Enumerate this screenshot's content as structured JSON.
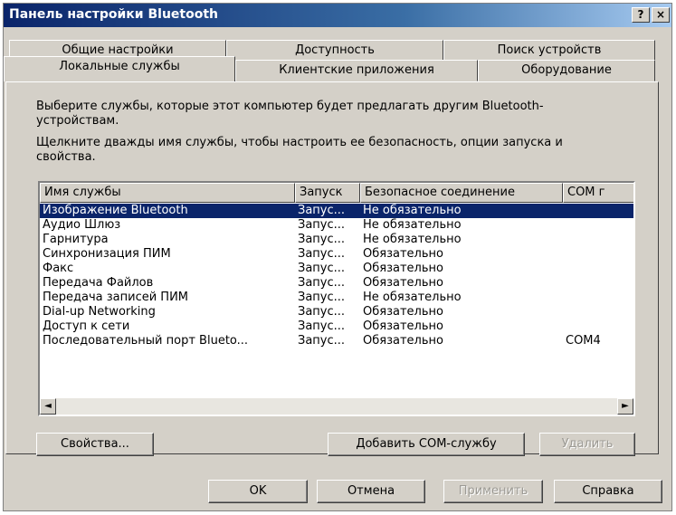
{
  "window": {
    "title": "Панель настройки Bluetooth",
    "help_button": "?",
    "close_button": "×"
  },
  "tabs_row1": [
    "Общие настройки",
    "Доступность",
    "Поиск устройств"
  ],
  "tabs_row2": [
    "Локальные службы",
    "Клиентские приложения",
    "Оборудование"
  ],
  "active_tab": "Локальные службы",
  "description": {
    "line1": "Выберите службы, которые этот компьютер будет предлагать другим Bluetooth-устройствам.",
    "line2": "Щелкните дважды имя службы, чтобы настроить ее безопасность, опции запуска и свойства."
  },
  "list": {
    "columns": [
      "Имя службы",
      "Запуск",
      "Безопасное соединение",
      "COM г"
    ],
    "rows": [
      {
        "name": "Изображение Bluetooth",
        "start": "Запус...",
        "secure": "Не обязательно",
        "com": ""
      },
      {
        "name": "Аудио Шлюз",
        "start": "Запус...",
        "secure": "Не обязательно",
        "com": ""
      },
      {
        "name": "Гарнитура",
        "start": "Запус...",
        "secure": "Не обязательно",
        "com": ""
      },
      {
        "name": "Синхронизация ПИМ",
        "start": "Запус...",
        "secure": "Обязательно",
        "com": ""
      },
      {
        "name": "Факс",
        "start": "Запус...",
        "secure": "Обязательно",
        "com": ""
      },
      {
        "name": "Передача Файлов",
        "start": "Запус...",
        "secure": "Обязательно",
        "com": ""
      },
      {
        "name": "Передача записей ПИМ",
        "start": "Запус...",
        "secure": "Не обязательно",
        "com": ""
      },
      {
        "name": "Dial-up Networking",
        "start": "Запус...",
        "secure": "Обязательно",
        "com": ""
      },
      {
        "name": "Доступ к сети",
        "start": "Запус...",
        "secure": "Обязательно",
        "com": ""
      },
      {
        "name": "Последовательный порт Blueto...",
        "start": "Запус...",
        "secure": "Обязательно",
        "com": "COM4"
      }
    ],
    "selected_index": 0
  },
  "buttons": {
    "properties": "Свойства...",
    "add_com": "Добавить COM-службу",
    "delete": "Удалить",
    "ok": "OK",
    "cancel": "Отмена",
    "apply": "Применить",
    "help": "Справка"
  },
  "scroll": {
    "left": "◄",
    "right": "►"
  }
}
